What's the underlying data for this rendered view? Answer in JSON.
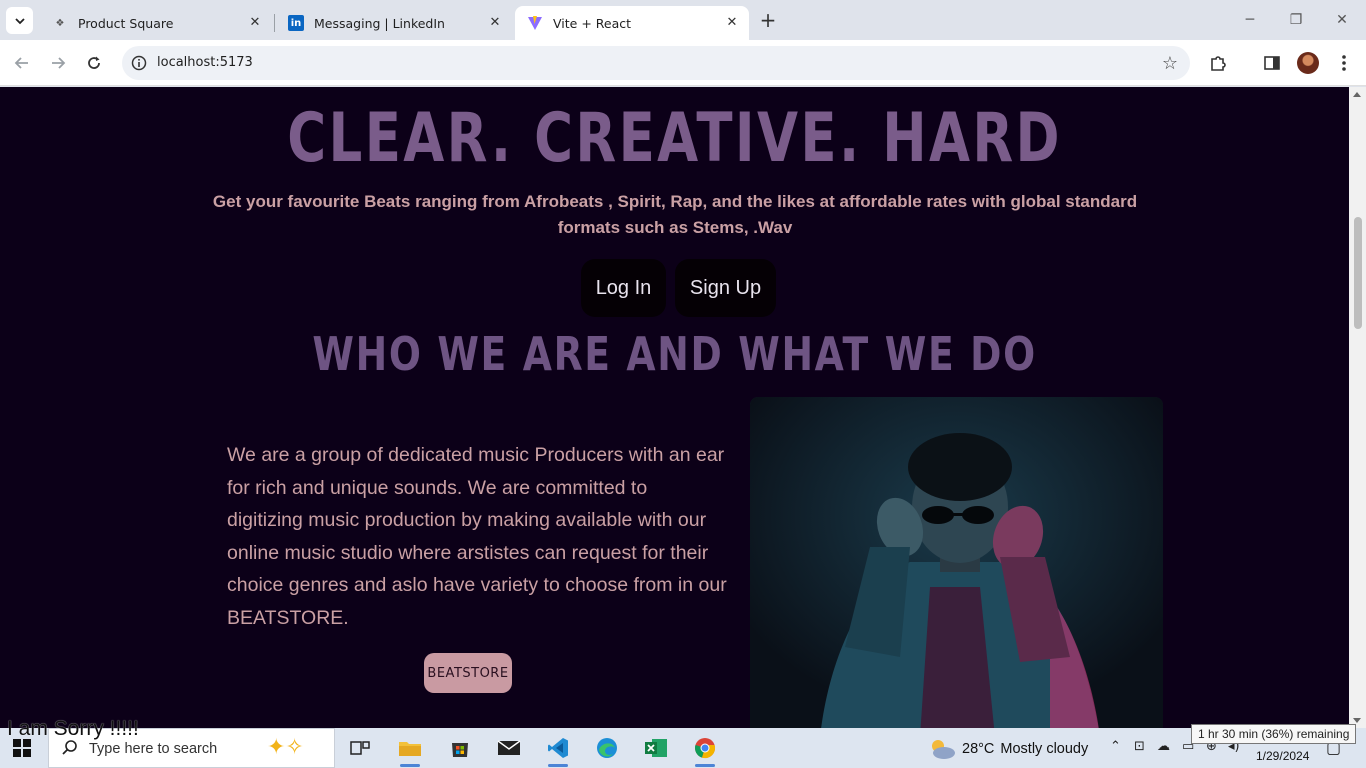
{
  "browser": {
    "tabs": [
      {
        "title": "Product Square",
        "favicon": "product-square-favicon"
      },
      {
        "title": "Messaging | LinkedIn",
        "favicon": "linkedin-favicon"
      },
      {
        "title": "Vite + React",
        "favicon": "vite-favicon",
        "active": true
      }
    ],
    "url": "localhost:5173"
  },
  "page": {
    "hero_title": "CLEAR. CREATIVE. HARD",
    "hero_subtitle": "Get your favourite Beats ranging from Afrobeats , Spirit, Rap, and the likes at affordable rates with global standard formats such as Stems, .Wav",
    "login_label": "Log In",
    "signup_label": "Sign Up",
    "section_title": "WHO WE ARE AND WHAT WE DO",
    "about_text": "We are a group of dedicated music Producers with an ear for rich and unique sounds. We are committed to digitizing music production by making available with our online music studio where arstistes can request for their choice genres and aslo have variety to choose from in our BEATSTORE.",
    "beatstore_label": "BEATSTORE",
    "colors": {
      "background": "#0c0018",
      "title": "#7a5c8a",
      "text": "#caa0a4",
      "accent_button": "#c99aa2"
    }
  },
  "overlay_text": "I am Sorry !!!!!",
  "taskbar": {
    "search_placeholder": "Type here to search",
    "weather_temp": "28°C",
    "weather_desc": "Mostly cloudy",
    "date": "1/29/2024",
    "battery_tooltip": "1 hr 30 min (36%) remaining",
    "apps": [
      "task-view",
      "file-explorer",
      "microsoft-store",
      "mail",
      "vscode",
      "edge",
      "excel",
      "chrome"
    ]
  }
}
